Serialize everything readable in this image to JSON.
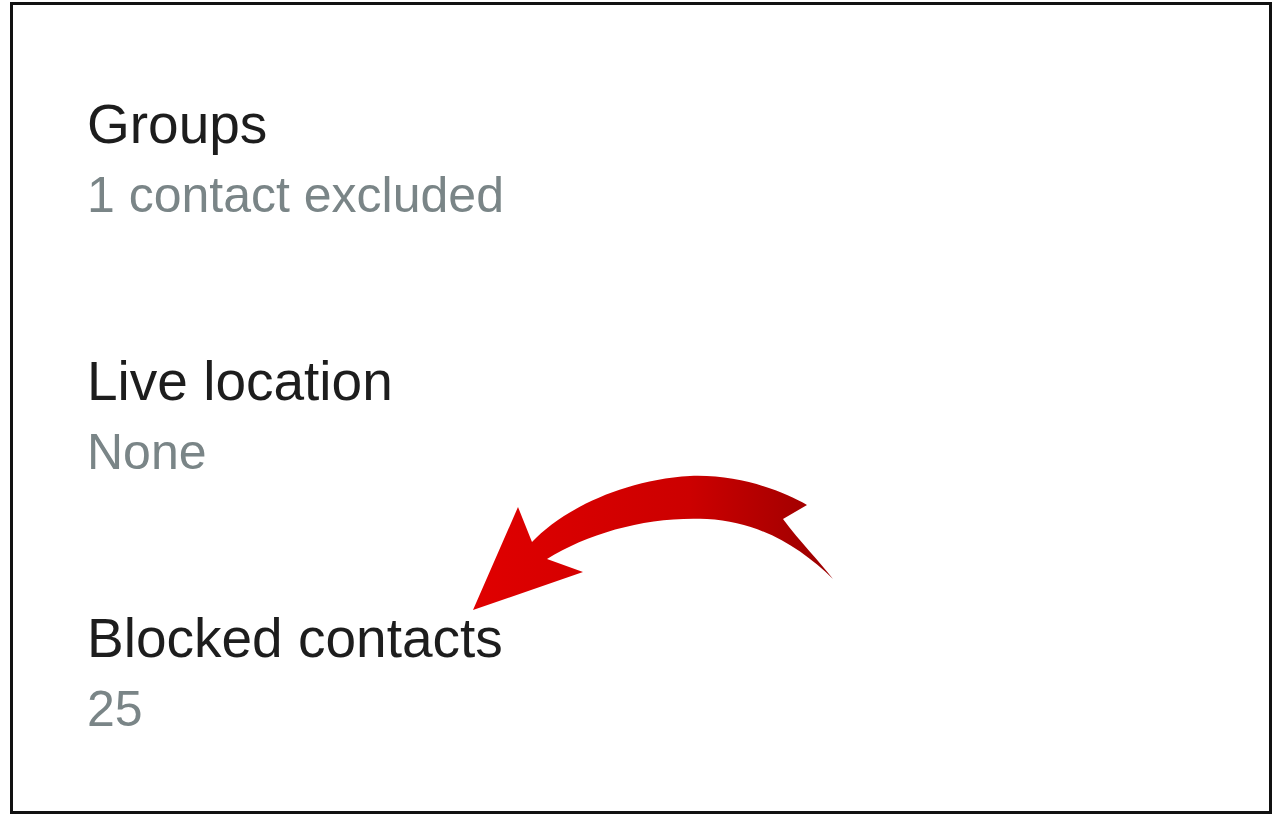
{
  "settings": {
    "items": [
      {
        "title": "Groups",
        "subtitle": "1 contact excluded"
      },
      {
        "title": "Live location",
        "subtitle": "None"
      },
      {
        "title": "Blocked contacts",
        "subtitle": "25"
      }
    ]
  }
}
